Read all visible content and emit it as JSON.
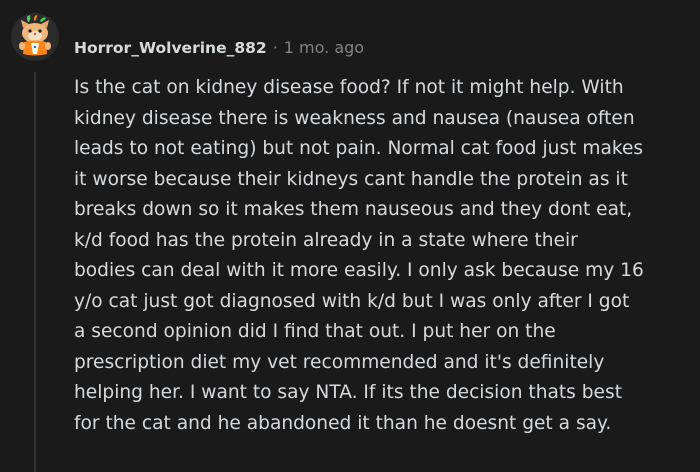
{
  "comment": {
    "username": "Horror_Wolverine_882",
    "separator": "·",
    "timestamp": "1 mo. ago",
    "avatar_icon": "snoo-avatar-icon",
    "body_lines": [
      "Is the cat on kidney disease food? If not it might help. With",
      "kidney disease there is weakness and nausea (nausea often",
      "leads to not eating) but not pain. Normal cat food just makes",
      "it worse because their kidneys cant handle the protein as it",
      "breaks down so it makes them nauseous and they dont eat,",
      "k/d food has the protein already in a state where their",
      "bodies can deal with it more easily. I only ask because my 16",
      "y/o cat just got diagnosed with k/d but I was only after I got",
      "a second opinion did I find that out. I put her on the",
      "prescription diet my vet recommended and it's definitely",
      "helping her. I want to say NTA. If its the decision thats best",
      "for the cat and he abandoned it than he doesnt get a say."
    ]
  },
  "colors": {
    "background": "#1a1a1b",
    "text": "#d7dadc",
    "meta": "#818384",
    "thread_line": "#343536"
  }
}
